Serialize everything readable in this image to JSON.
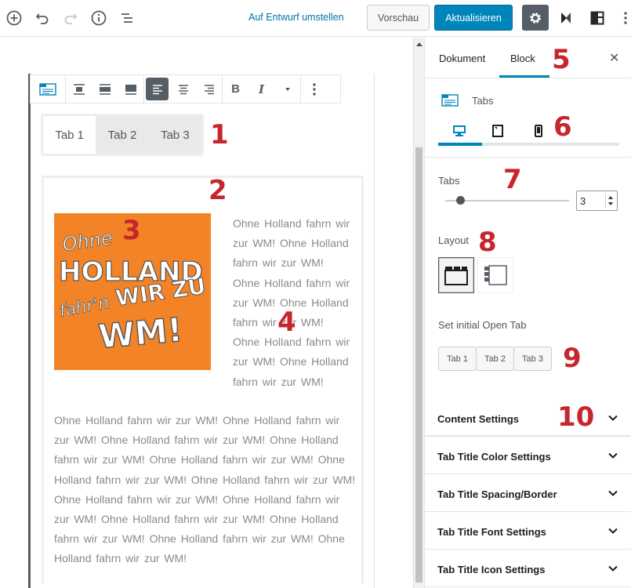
{
  "toolbar": {
    "add_icon": "plus-circle-icon",
    "undo_icon": "undo-icon",
    "redo_icon": "redo-icon",
    "info_icon": "info-icon",
    "outline_icon": "list-icon",
    "draft_link": "Auf Entwurf umstellen",
    "preview_label": "Vorschau",
    "update_label": "Aktualisieren",
    "settings_icon": "gear-icon",
    "plugin_icon": "k-logo-icon",
    "layout_icon": "layout-icon",
    "more_icon": "more-vertical-icon",
    "accent": "#0085ba"
  },
  "block_toolbar": {
    "block_icon": "tabs-block-icon",
    "align_icons": [
      "align-wide-top-icon",
      "align-center-icon",
      "align-full-icon"
    ],
    "text_align_icons": [
      "align-left-icon",
      "align-center-text-icon",
      "align-right-icon"
    ],
    "bold": "B",
    "italic": "I",
    "more_icon": "more-vertical-icon"
  },
  "tabs_block": {
    "tab_titles": [
      "Tab 1",
      "Tab 2",
      "Tab 3"
    ],
    "image_text": [
      "Ohne",
      "HOLLAND",
      "fahr'n",
      "WIR ZU",
      "WM!"
    ],
    "image_color": "#f28326",
    "float_text": "Ohne Holland fahrn wir zur WM! Ohne Holland fahrn wir zur WM! Ohne Holland fahrn wir zur WM! Ohne Holland fahrn wir zur WM! Ohne Holland fahrn wir zur WM! Ohne Holland fahrn wir zur WM!",
    "full_text": "Ohne Holland fahrn wir zur WM! Ohne Holland fahrn wir zur WM! Ohne Holland fahrn wir zur WM! Ohne Holland fahrn wir zur WM! Ohne Holland fahrn wir zur WM! Ohne Holland fahrn wir zur WM! Ohne Holland fahrn wir zur WM! Ohne Holland fahrn wir zur WM! Ohne Holland fahrn wir zur WM! Ohne Holland fahrn wir zur WM! Ohne Holland fahrn wir zur WM! Ohne Holland fahrn wir zur WM! Ohne Holland fahrn wir zur WM!"
  },
  "sidebar": {
    "tab_document": "Dokument",
    "tab_block": "Block",
    "close_icon": "close-icon",
    "block_name": "Tabs",
    "device_icons": [
      "desktop-icon",
      "tablet-icon",
      "mobile-icon"
    ],
    "tabs_label": "Tabs",
    "tabs_count": "3",
    "tabs_slider_value": 3,
    "layout_label": "Layout",
    "layout_options": [
      "horizontal-tabs-icon",
      "vertical-tabs-icon"
    ],
    "initial_open_label": "Set initial Open Tab",
    "initial_open_options": [
      "Tab 1",
      "Tab 2",
      "Tab 3"
    ],
    "accordion": [
      "Content Settings",
      "Tab Title Color Settings",
      "Tab Title Spacing/Border",
      "Tab Title Font Settings",
      "Tab Title Icon Settings"
    ]
  },
  "annotations": [
    "1",
    "2",
    "3",
    "4",
    "5",
    "6",
    "7",
    "8",
    "9",
    "10"
  ],
  "annotation_color": "#c6272c"
}
